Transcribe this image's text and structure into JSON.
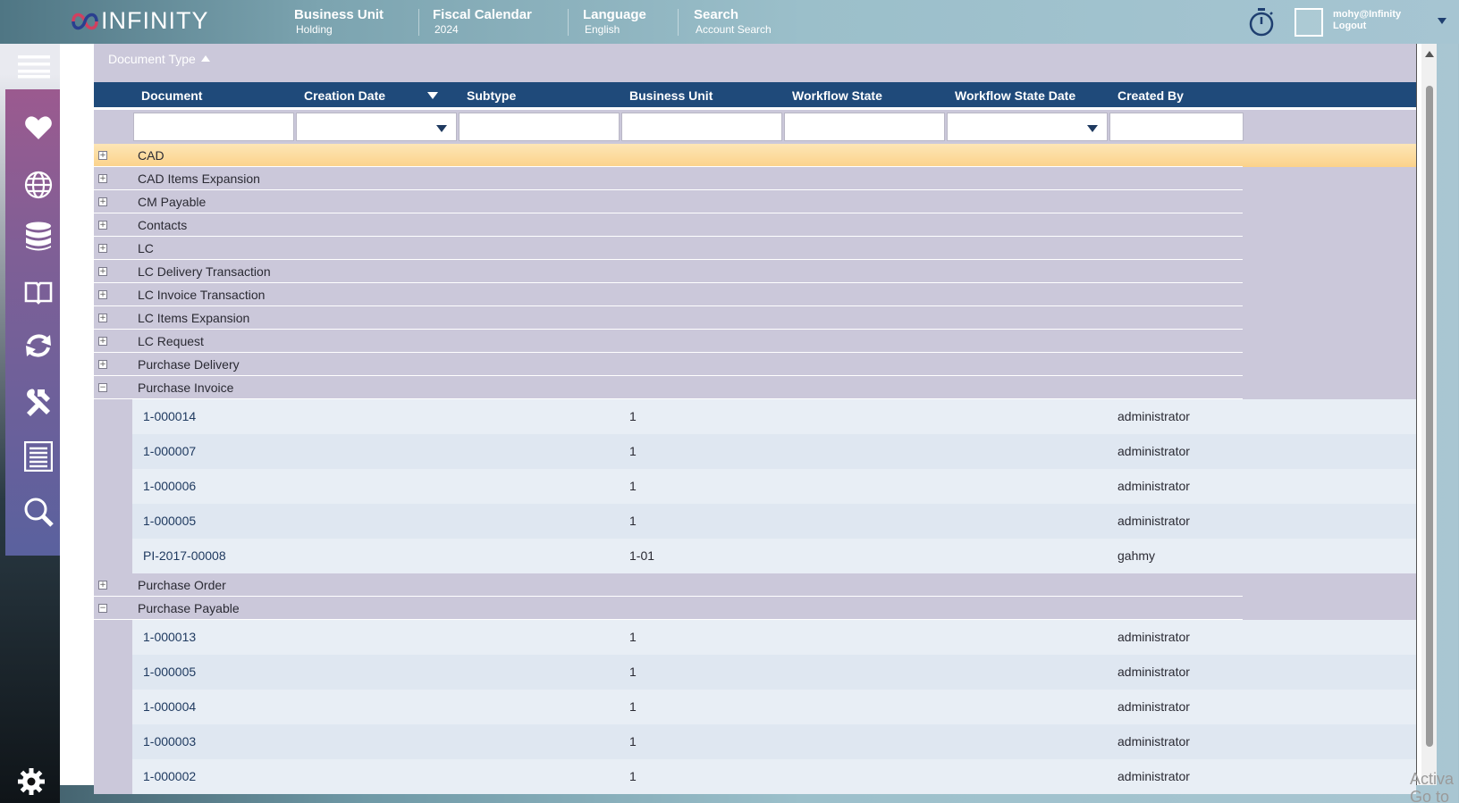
{
  "brand": {
    "name": "INFINITY"
  },
  "topbar": {
    "menus": [
      {
        "title": "Business Unit",
        "sub": "Holding"
      },
      {
        "title": "Fiscal Calendar",
        "sub": "2024"
      },
      {
        "title": "Language",
        "sub": "English"
      },
      {
        "title": "Search",
        "sub": "Account Search"
      }
    ],
    "user": {
      "name": "mohy@Infinity",
      "logout": "Logout"
    }
  },
  "sidebar": {
    "icons": [
      "menu-icon",
      "heart-icon",
      "globe-icon",
      "database-icon",
      "book-icon",
      "refresh-icon",
      "tools-icon",
      "list-icon",
      "search-icon",
      "gear-icon"
    ]
  },
  "grid": {
    "group_by": "Document Type",
    "columns": [
      "Document",
      "Creation Date",
      "Subtype",
      "Business Unit",
      "Workflow State",
      "Workflow State Date",
      "Created By"
    ],
    "groups": [
      {
        "label": "CAD",
        "expanded": false,
        "selected": true,
        "rows": []
      },
      {
        "label": "CAD Items Expansion",
        "expanded": false,
        "rows": []
      },
      {
        "label": "CM Payable",
        "expanded": false,
        "rows": []
      },
      {
        "label": "Contacts",
        "expanded": false,
        "rows": []
      },
      {
        "label": "LC",
        "expanded": false,
        "rows": []
      },
      {
        "label": "LC Delivery Transaction",
        "expanded": false,
        "rows": []
      },
      {
        "label": "LC Invoice Transaction",
        "expanded": false,
        "rows": []
      },
      {
        "label": "LC Items Expansion",
        "expanded": false,
        "rows": []
      },
      {
        "label": "LC Request",
        "expanded": false,
        "rows": []
      },
      {
        "label": "Purchase Delivery",
        "expanded": false,
        "rows": []
      },
      {
        "label": "Purchase Invoice",
        "expanded": true,
        "rows": [
          {
            "document": "1-000014",
            "business_unit": "1",
            "created_by": "administrator"
          },
          {
            "document": "1-000007",
            "business_unit": "1",
            "created_by": "administrator"
          },
          {
            "document": "1-000006",
            "business_unit": "1",
            "created_by": "administrator"
          },
          {
            "document": "1-000005",
            "business_unit": "1",
            "created_by": "administrator"
          },
          {
            "document": "PI-2017-00008",
            "business_unit": "1-01",
            "created_by": "gahmy"
          }
        ]
      },
      {
        "label": "Purchase Order",
        "expanded": false,
        "rows": []
      },
      {
        "label": "Purchase Payable",
        "expanded": true,
        "rows": [
          {
            "document": "1-000013",
            "business_unit": "1",
            "created_by": "administrator"
          },
          {
            "document": "1-000005",
            "business_unit": "1",
            "created_by": "administrator"
          },
          {
            "document": "1-000004",
            "business_unit": "1",
            "created_by": "administrator"
          },
          {
            "document": "1-000003",
            "business_unit": "1",
            "created_by": "administrator"
          },
          {
            "document": "1-000002",
            "business_unit": "1",
            "created_by": "administrator"
          }
        ]
      }
    ]
  },
  "watermark": {
    "line1": "Activa",
    "line2": "Go to Se"
  },
  "colors": {
    "header": "#1f4a7a",
    "group_row": "#cbc8da",
    "selected_row": "#fbd28a",
    "sidebar": "#7f5f96"
  }
}
